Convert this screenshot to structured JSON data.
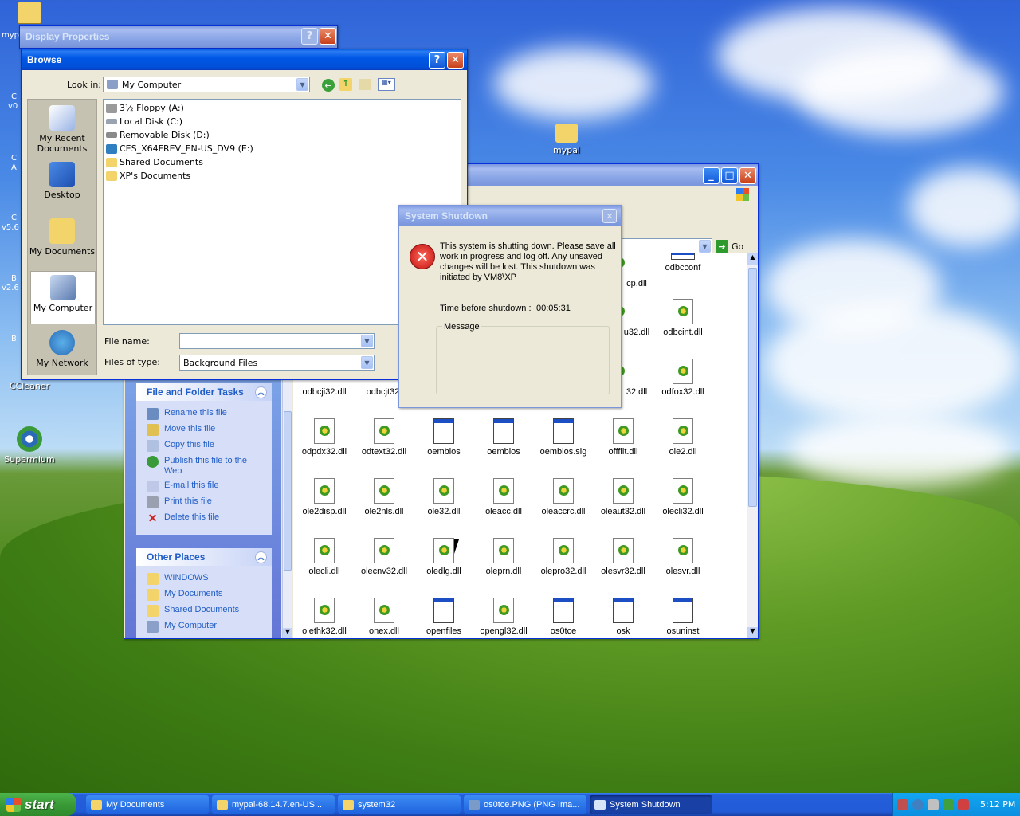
{
  "desktop": {
    "icons": [
      {
        "label": "mypal",
        "name": "desktop-icon-mypal"
      },
      {
        "label": "CCleaner",
        "name": "desktop-icon-ccleaner"
      },
      {
        "label": "Supermium",
        "name": "desktop-icon-supermium"
      }
    ],
    "edge_labels": [
      "myp",
      "C",
      "v0",
      "C",
      "A",
      "C",
      "v5.6",
      "B",
      "v2.6",
      "B"
    ]
  },
  "display_properties": {
    "title": "Display Properties"
  },
  "browse": {
    "title": "Browse",
    "look_in_label": "Look in:",
    "look_in_value": "My Computer",
    "places": [
      "My Recent Documents",
      "Desktop",
      "My Documents",
      "My Computer",
      "My Network"
    ],
    "items": [
      {
        "label": "3½ Floppy (A:)",
        "color": "#9a9a9a"
      },
      {
        "label": "Local Disk (C:)",
        "color": "#9aa4b0"
      },
      {
        "label": "Removable Disk (D:)",
        "color": "#8a8a8a"
      },
      {
        "label": "CES_X64FREV_EN-US_DV9 (E:)",
        "color": "#2f7fc0"
      },
      {
        "label": "Shared Documents",
        "color": "#f2d46a"
      },
      {
        "label": "XP's Documents",
        "color": "#f2d46a"
      }
    ],
    "file_name_label": "File name:",
    "file_name_value": "",
    "files_of_type_label": "Files of type:",
    "files_of_type_value": "Background Files"
  },
  "explorer": {
    "go_label": "Go",
    "file_tasks": {
      "header": "File and Folder Tasks",
      "items": [
        "Rename this file",
        "Move this file",
        "Copy this file",
        "Publish this file to the Web",
        "E-mail this file",
        "Print this file",
        "Delete this file"
      ]
    },
    "other_places": {
      "header": "Other Places",
      "items": [
        "WINDOWS",
        "My Documents",
        "Shared Documents",
        "My Computer"
      ]
    },
    "files_partial": [
      {
        "label": "cp.dll",
        "type": "dll"
      },
      {
        "label": "odbcconf",
        "type": "app"
      },
      {
        "label": "u32.dll",
        "type": "dll"
      },
      {
        "label": "odbcint.dll",
        "type": "dll"
      },
      {
        "label": "odbcji32.dll",
        "type": "dll"
      },
      {
        "label": "odbcjt32.",
        "type": "dll"
      },
      {
        "label": "32.dll",
        "type": "dll"
      },
      {
        "label": "odfox32.dll",
        "type": "dll"
      }
    ],
    "files": [
      {
        "label": "odpdx32.dll",
        "type": "dll"
      },
      {
        "label": "odtext32.dll",
        "type": "dll"
      },
      {
        "label": "oembios",
        "type": "app"
      },
      {
        "label": "oembios",
        "type": "app"
      },
      {
        "label": "oembios.sig",
        "type": "app"
      },
      {
        "label": "offfilt.dll",
        "type": "dll"
      },
      {
        "label": "ole2.dll",
        "type": "dll"
      },
      {
        "label": "ole2disp.dll",
        "type": "dll"
      },
      {
        "label": "ole2nls.dll",
        "type": "dll"
      },
      {
        "label": "ole32.dll",
        "type": "dll"
      },
      {
        "label": "oleacc.dll",
        "type": "dll"
      },
      {
        "label": "oleaccrc.dll",
        "type": "dll"
      },
      {
        "label": "oleaut32.dll",
        "type": "dll"
      },
      {
        "label": "olecli32.dll",
        "type": "dll"
      },
      {
        "label": "olecli.dll",
        "type": "dll"
      },
      {
        "label": "olecnv32.dll",
        "type": "dll"
      },
      {
        "label": "oledlg.dll",
        "type": "dll"
      },
      {
        "label": "oleprn.dll",
        "type": "dll"
      },
      {
        "label": "olepro32.dll",
        "type": "dll"
      },
      {
        "label": "olesvr32.dll",
        "type": "dll"
      },
      {
        "label": "olesvr.dll",
        "type": "dll"
      },
      {
        "label": "olethk32.dll",
        "type": "dll"
      },
      {
        "label": "onex.dll",
        "type": "dll"
      },
      {
        "label": "openfiles",
        "type": "app"
      },
      {
        "label": "opengl32.dll",
        "type": "dll"
      },
      {
        "label": "os0tce",
        "type": "app"
      },
      {
        "label": "osk",
        "type": "app"
      },
      {
        "label": "osuninst",
        "type": "app"
      }
    ]
  },
  "shutdown": {
    "title": "System Shutdown",
    "message": "This system is shutting down. Please save all work in progress and log off. Any unsaved changes will be lost. This shutdown was initiated by VM8\\XP",
    "time_label": "Time before shutdown :",
    "time_value": "00:05:31",
    "message_group_label": "Message"
  },
  "taskbar": {
    "start_label": "start",
    "tasks": [
      {
        "label": "My Documents",
        "color": "#f2d46a"
      },
      {
        "label": "mypal-68.14.7.en-US...",
        "color": "#f2d46a"
      },
      {
        "label": "system32",
        "color": "#f2d46a"
      },
      {
        "label": "os0tce.PNG (PNG Ima...",
        "color": "#7a9ac8"
      },
      {
        "label": "System Shutdown",
        "color": "#d8e4f8"
      }
    ],
    "clock": "5:12 PM"
  }
}
